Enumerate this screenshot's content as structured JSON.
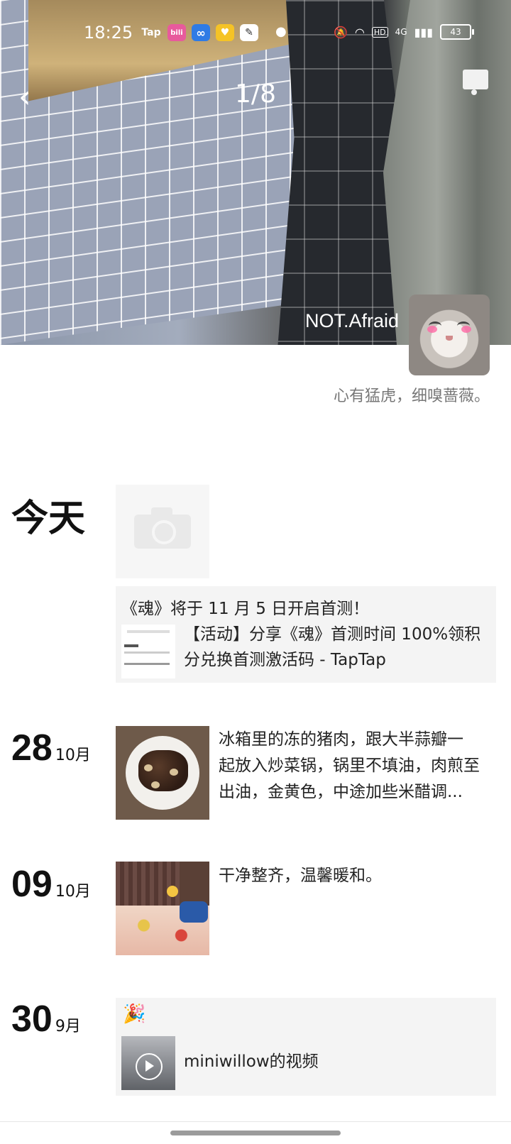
{
  "status_bar": {
    "time": "18:25",
    "apps": [
      {
        "name": "tap-icon",
        "label": "Tap",
        "color": "#ffffff"
      },
      {
        "name": "bilibili-icon",
        "label": "bili",
        "color": "#e85a9c"
      },
      {
        "name": "infinity-icon",
        "label": "∞",
        "color": "#2f7be5"
      },
      {
        "name": "heart-app-icon",
        "label": "♥",
        "color": "#f5c326"
      },
      {
        "name": "feather-app-icon",
        "label": "✎",
        "color": "#ffffff"
      }
    ],
    "network": "4G",
    "battery": "43"
  },
  "nav": {
    "page_indicator": "1/8"
  },
  "profile": {
    "username": "NOT.Afraid",
    "signature": "心有猛虎，细嗅蔷薇。"
  },
  "timeline": {
    "today": {
      "label": "今天",
      "share": {
        "title": "《魂》将于 11 月 5 日开启首测！",
        "desc_line1": "【活动】分享《魂》首测时间 100%领积",
        "desc_line2": "分兑换首测激活码 - TapTap"
      }
    },
    "post_28": {
      "day": "28",
      "month": "10月",
      "text_line1": "冰箱里的冻的猪肉，跟大半蒜瓣一",
      "text_line2": "起放入炒菜锅，锅里不填油，肉煎至",
      "text_line3": "出油，金黄色，中途加些米醋调..."
    },
    "post_09": {
      "day": "09",
      "month": "10月",
      "text": "干净整齐，温馨暖和。"
    },
    "post_30": {
      "day": "30",
      "month": "9月",
      "emoji": "🎉",
      "video_title": "miniwillow的视频"
    }
  }
}
